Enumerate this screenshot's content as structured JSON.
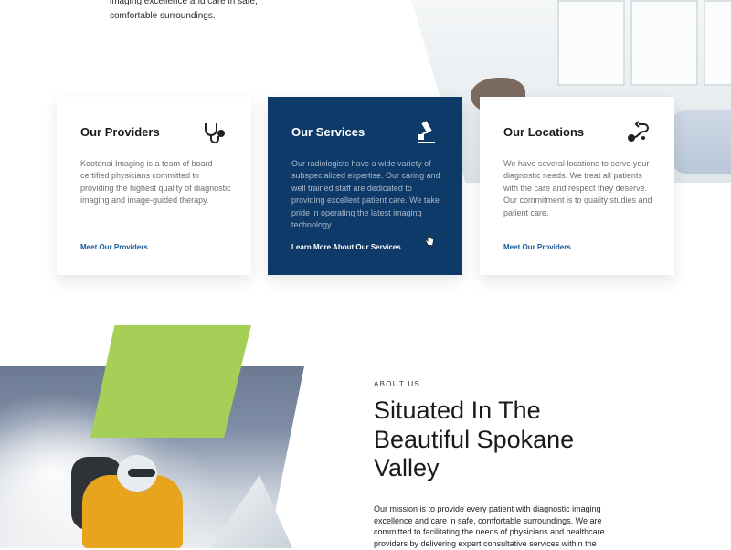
{
  "hero": {
    "text_line1": "imaging excellence and care in safe,",
    "text_line2": "comfortable surroundings."
  },
  "cards": [
    {
      "title": "Our Providers",
      "icon": "stethoscope-icon",
      "body": "Kootenai Imaging  is a team of board certified physicians committed to providing the highest quality of diagnostic imaging and image-guided therapy.",
      "link": "Meet Our Providers"
    },
    {
      "title": "Our Services",
      "icon": "microscope-icon",
      "body": "Our radiologists have a wide variety of subspecialized expertise. Our caring and well trained staff are dedicated to providing excellent patient care. We take pride in operating the latest imaging technology.",
      "link": "Learn More About Our Services"
    },
    {
      "title": "Our Locations",
      "icon": "route-icon",
      "body": "We have several locations to serve your diagnostic needs.  We treat all patients with the care and respect they deserve. Our commitment is to quality studies and patient care.",
      "link": "Meet Our Providers"
    }
  ],
  "about": {
    "eyebrow": "ABOUT US",
    "heading": "Situated In The Beautiful Spokane Valley",
    "body": "Our mission is to provide every patient with diagnostic imaging excellence and care in safe, comfortable surroundings. We are committed to facilitating the needs of physicians and healthcare providers by delivering expert consultative services within the"
  },
  "colors": {
    "featured_card": "#0e3a6a",
    "link": "#1b5a9a",
    "accent_green": "#a5cf57"
  }
}
